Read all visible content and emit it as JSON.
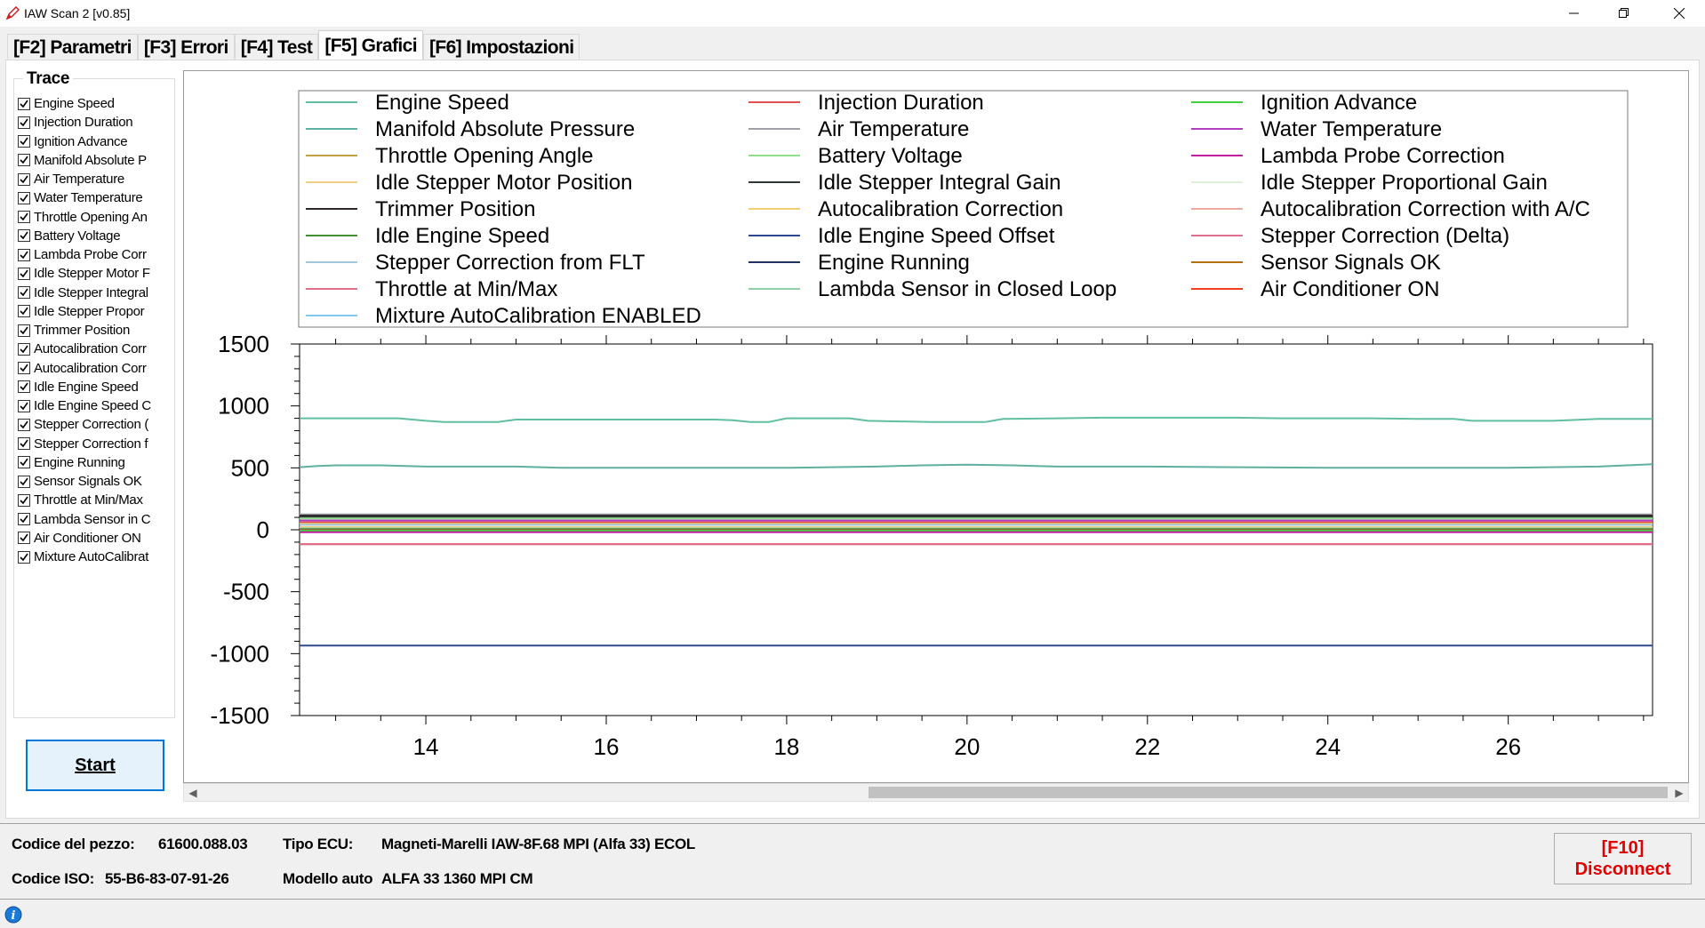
{
  "window": {
    "title": "IAW Scan 2 [v0.85]"
  },
  "tabs": [
    {
      "label": "[F2] Parametri",
      "active": false
    },
    {
      "label": "[F3] Errori",
      "active": false
    },
    {
      "label": "[F4] Test",
      "active": false
    },
    {
      "label": "[F5] Grafici",
      "active": true
    },
    {
      "label": "[F6] Impostazioni",
      "active": false
    }
  ],
  "trace": {
    "title": "Trace",
    "items": [
      {
        "label": "Engine Speed",
        "checked": true
      },
      {
        "label": "Injection Duration",
        "checked": true
      },
      {
        "label": "Ignition Advance",
        "checked": true
      },
      {
        "label": "Manifold Absolute P",
        "checked": true
      },
      {
        "label": "Air Temperature",
        "checked": true
      },
      {
        "label": "Water Temperature",
        "checked": true
      },
      {
        "label": "Throttle Opening An",
        "checked": true
      },
      {
        "label": "Battery Voltage",
        "checked": true
      },
      {
        "label": "Lambda Probe Corr",
        "checked": true
      },
      {
        "label": "Idle Stepper Motor F",
        "checked": true
      },
      {
        "label": "Idle Stepper Integral",
        "checked": true
      },
      {
        "label": "Idle Stepper Propor",
        "checked": true
      },
      {
        "label": "Trimmer Position",
        "checked": true
      },
      {
        "label": "Autocalibration Corr",
        "checked": true
      },
      {
        "label": "Autocalibration Corr",
        "checked": true
      },
      {
        "label": "Idle Engine Speed",
        "checked": true
      },
      {
        "label": "Idle Engine Speed C",
        "checked": true
      },
      {
        "label": "Stepper Correction (",
        "checked": true
      },
      {
        "label": "Stepper Correction f",
        "checked": true
      },
      {
        "label": "Engine Running",
        "checked": true
      },
      {
        "label": "Sensor Signals OK",
        "checked": true
      },
      {
        "label": "Throttle at Min/Max",
        "checked": true
      },
      {
        "label": "Lambda Sensor in C",
        "checked": true
      },
      {
        "label": "Air Conditioner ON",
        "checked": true
      },
      {
        "label": "Mixture AutoCalibrat",
        "checked": true
      }
    ]
  },
  "buttons": {
    "start": "Start",
    "disconnect_key": "[F10]",
    "disconnect_label": "Disconnect"
  },
  "info": {
    "part_code_label": "Codice del pezzo:",
    "part_code_value": "61600.088.03",
    "ecu_type_label": "Tipo ECU:",
    "ecu_type_value": "Magneti-Marelli IAW-8F.68 MPI (Alfa 33) ECOL",
    "iso_code_label": "Codice ISO:",
    "iso_code_value": "55-B6-83-07-91-26",
    "car_model_label": "Modello auto",
    "car_model_value": "ALFA 33 1360 MPI CM"
  },
  "chart_data": {
    "type": "line",
    "xlim": [
      12.6,
      27.6
    ],
    "ylim": [
      -1500,
      1500
    ],
    "xticks": [
      14,
      16,
      18,
      20,
      22,
      24,
      26
    ],
    "yticks": [
      1500,
      1000,
      500,
      0,
      -500,
      -1000,
      -1500
    ],
    "legend_position": "top",
    "legend": [
      {
        "name": "Engine Speed",
        "color": "#5fbf9f"
      },
      {
        "name": "Injection Duration",
        "color": "#e05050"
      },
      {
        "name": "Ignition Advance",
        "color": "#40d040"
      },
      {
        "name": "Manifold Absolute Pressure",
        "color": "#5fb0a0"
      },
      {
        "name": "Air Temperature",
        "color": "#a0a0a8"
      },
      {
        "name": "Water Temperature",
        "color": "#b040c0"
      },
      {
        "name": "Throttle Opening Angle",
        "color": "#c0a040"
      },
      {
        "name": "Battery Voltage",
        "color": "#90e090"
      },
      {
        "name": "Lambda Probe Correction",
        "color": "#c020a0"
      },
      {
        "name": "Idle Stepper Motor Position",
        "color": "#f0d080"
      },
      {
        "name": "Idle Stepper Integral Gain",
        "color": "#303838"
      },
      {
        "name": "Idle Stepper Proportional Gain",
        "color": "#e0f0d8"
      },
      {
        "name": "Trimmer Position",
        "color": "#302828"
      },
      {
        "name": "Autocalibration Correction",
        "color": "#f0d070"
      },
      {
        "name": "Autocalibration Correction with A/C",
        "color": "#f0a8a0"
      },
      {
        "name": "Idle Engine Speed",
        "color": "#409030"
      },
      {
        "name": "Idle Engine Speed Offset",
        "color": "#304890"
      },
      {
        "name": "Stepper Correction (Delta)",
        "color": "#e07090"
      },
      {
        "name": "Stepper Correction from FLT",
        "color": "#a0c8d8"
      },
      {
        "name": "Engine Running",
        "color": "#203060"
      },
      {
        "name": "Sensor Signals OK",
        "color": "#b07010"
      },
      {
        "name": "Throttle at Min/Max",
        "color": "#e07088"
      },
      {
        "name": "Lambda Sensor in Closed Loop",
        "color": "#90d0a8"
      },
      {
        "name": "Air Conditioner ON",
        "color": "#f04020"
      },
      {
        "name": "Mixture AutoCalibration ENABLED",
        "color": "#80c8f0"
      }
    ],
    "series": [
      {
        "legend_index": 0,
        "x": [
          12.6,
          13.5,
          13.7,
          14.0,
          14.2,
          14.8,
          15.0,
          16.0,
          16.5,
          17.0,
          17.2,
          17.4,
          17.6,
          17.8,
          18.0,
          18.7,
          18.9,
          19.6,
          20.2,
          20.4,
          21.0,
          21.5,
          22.5,
          23.0,
          23.5,
          24.0,
          24.5,
          25.0,
          25.4,
          25.6,
          26.0,
          26.5,
          27.0,
          27.6
        ],
        "y": [
          900,
          900,
          900,
          880,
          870,
          870,
          890,
          890,
          890,
          890,
          890,
          885,
          870,
          870,
          900,
          900,
          880,
          870,
          870,
          895,
          900,
          905,
          905,
          905,
          900,
          900,
          900,
          895,
          895,
          880,
          880,
          880,
          895,
          895
        ]
      },
      {
        "legend_index": 3,
        "x": [
          12.6,
          12.8,
          13.0,
          13.5,
          14.0,
          15.0,
          15.5,
          16.0,
          17.0,
          18.0,
          19.0,
          19.5,
          20.0,
          20.5,
          21.0,
          22.0,
          23.0,
          24.0,
          25.0,
          26.0,
          27.0,
          27.6
        ],
        "y": [
          505,
          515,
          520,
          520,
          510,
          510,
          500,
          500,
          500,
          500,
          510,
          520,
          525,
          520,
          510,
          510,
          505,
          500,
          500,
          500,
          510,
          530
        ]
      },
      {
        "legend_index": 4,
        "y_const": 125
      },
      {
        "legend_index": 12,
        "y_const": 115
      },
      {
        "legend_index": 10,
        "y_const": 105
      },
      {
        "legend_index": 7,
        "y_const": 92
      },
      {
        "legend_index": 5,
        "y_const": 75
      },
      {
        "legend_index": 1,
        "y_const": 60
      },
      {
        "legend_index": 13,
        "y_const": 48
      },
      {
        "legend_index": 18,
        "y_const": 40
      },
      {
        "legend_index": 9,
        "y_const": 22
      },
      {
        "legend_index": 22,
        "y_const": 12
      },
      {
        "legend_index": 15,
        "y_const": 4
      },
      {
        "legend_index": 20,
        "y_const": 0
      },
      {
        "legend_index": 19,
        "y_const": -2
      },
      {
        "legend_index": 23,
        "y_const": -4
      },
      {
        "legend_index": 6,
        "y_const": -6
      },
      {
        "legend_index": 2,
        "y_const": -8
      },
      {
        "legend_index": 8,
        "y_const": -20
      },
      {
        "legend_index": 17,
        "y_const": -115
      },
      {
        "legend_index": 21,
        "y_const": -118
      },
      {
        "legend_index": 16,
        "y_const": -935
      }
    ]
  }
}
